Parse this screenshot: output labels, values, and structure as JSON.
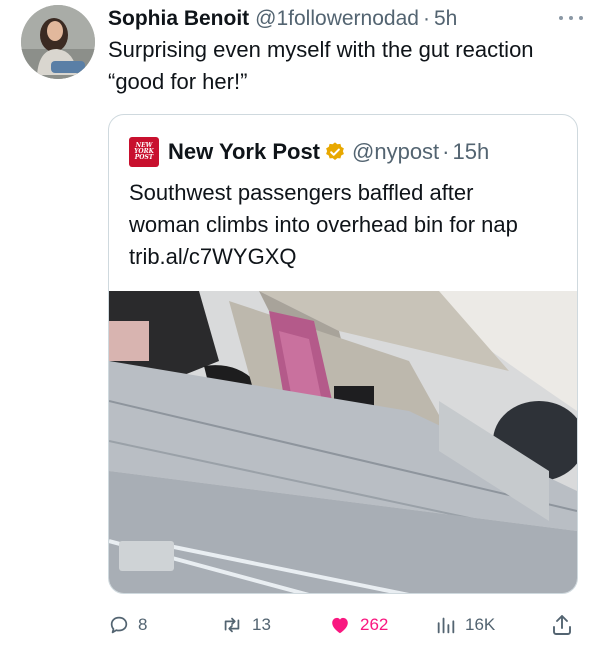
{
  "tweet": {
    "author_name": "Sophia Benoit",
    "author_handle": "@1followernodad",
    "separator": "·",
    "time": "5h",
    "text": "Surprising even myself with the gut reaction “good for her!”"
  },
  "quoted_tweet": {
    "logo_text": [
      "NEW",
      "YORK",
      "POST"
    ],
    "author_name": "New York Post",
    "verified_badge_color": "#e8a800",
    "author_handle": "@nypost",
    "separator": "·",
    "time": "15h",
    "text": "Southwest passengers baffled after woman climbs into overhead bin for nap trib.al/c7WYGXQ"
  },
  "actions": {
    "replies": "8",
    "retweets": "13",
    "likes": "262",
    "views": "16K"
  },
  "colors": {
    "text": "#0f1419",
    "secondary": "#536471",
    "like": "#f91880",
    "brand_red": "#c8102e",
    "border": "#cfd9de"
  },
  "icons": [
    "more-icon",
    "reply-icon",
    "retweet-icon",
    "heart-icon",
    "views-icon",
    "share-icon",
    "verified-badge-icon"
  ]
}
